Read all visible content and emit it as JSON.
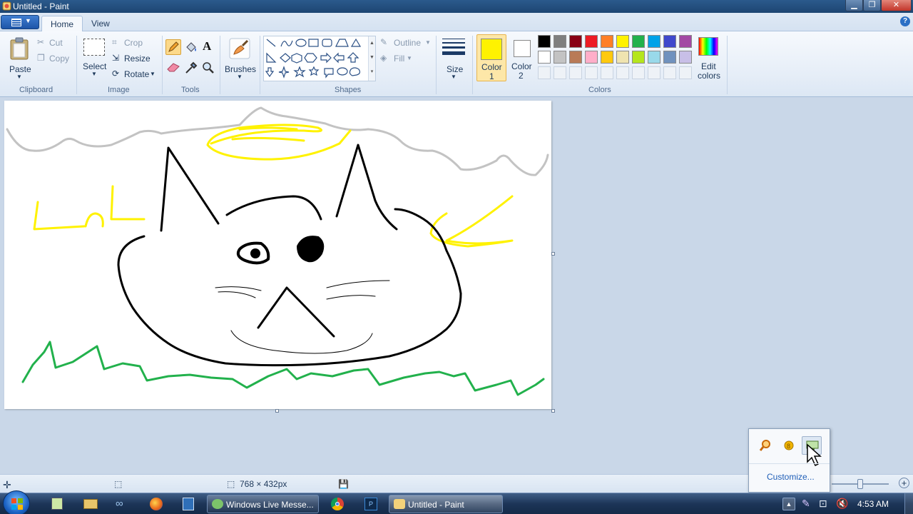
{
  "window": {
    "title": "Untitled - Paint"
  },
  "tabs": {
    "home": "Home",
    "view": "View"
  },
  "help_symbol": "?",
  "clipboard": {
    "paste": "Paste",
    "cut": "Cut",
    "copy": "Copy",
    "group": "Clipboard"
  },
  "image": {
    "select": "Select",
    "crop": "Crop",
    "resize": "Resize",
    "rotate": "Rotate",
    "group": "Image"
  },
  "tools": {
    "group": "Tools"
  },
  "brushes": {
    "label": "Brushes"
  },
  "shapes": {
    "outline": "Outline",
    "fill": "Fill",
    "group": "Shapes"
  },
  "size": {
    "label": "Size"
  },
  "colors": {
    "color1_line1": "Color",
    "color1_line2": "1",
    "color2_line1": "Color",
    "color2_line2": "2",
    "edit_line1": "Edit",
    "edit_line2": "colors",
    "group": "Colors",
    "color1": "#FFF200",
    "color2": "#FFFFFF",
    "row1": [
      "#000000",
      "#7F7F7F",
      "#880015",
      "#ED1C24",
      "#FF7F27",
      "#FFF200",
      "#22B14C",
      "#00A2E8",
      "#3F48CC",
      "#A349A4"
    ],
    "row2": [
      "#FFFFFF",
      "#C3C3C3",
      "#B97A57",
      "#FFAEC9",
      "#FFC90E",
      "#EFE4B0",
      "#B5E61D",
      "#99D9EA",
      "#7092BE",
      "#C8BFE7"
    ]
  },
  "status": {
    "dimensions": "768 × 432px"
  },
  "tray": {
    "customize": "Customize..."
  },
  "taskbar": {
    "messenger": "Windows Live Messe...",
    "paint": "Untitled - Paint",
    "clock": "4:53 AM"
  }
}
